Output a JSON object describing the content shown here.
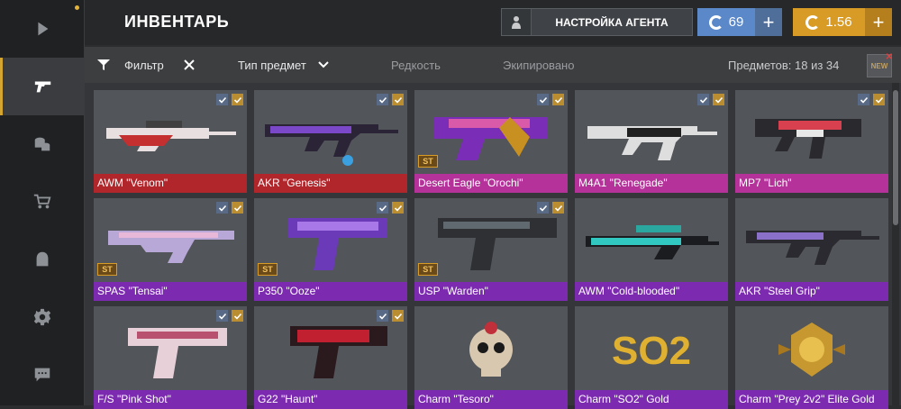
{
  "sidebar": {
    "items": [
      {
        "icon": "play-icon"
      },
      {
        "icon": "pistol-icon",
        "active": true
      },
      {
        "icon": "coins-icon"
      },
      {
        "icon": "cart-icon"
      },
      {
        "icon": "agent-icon"
      },
      {
        "icon": "gear-icon"
      },
      {
        "icon": "chat-icon"
      }
    ]
  },
  "header": {
    "title": "ИНВЕНТАРЬ",
    "agent_button": "НАСТРОЙКА АГЕНТА",
    "currency1": "69",
    "currency2": "1.56"
  },
  "filterbar": {
    "filter_label": "Фильтр",
    "type_label": "Тип предмет",
    "rarity_label": "Редкость",
    "equipped_label": "Экипировано",
    "count_label": "Предметов: 18 из 34",
    "new_label": "NEW"
  },
  "colors": {
    "accent": "#d89b26",
    "blue": "#5b88c9",
    "red": "#b0262b",
    "pink": "#b5329a",
    "purple": "#7c2ab0"
  },
  "items": [
    {
      "name": "AWM \"Venom\"",
      "color": "red",
      "st": false,
      "checks": 2
    },
    {
      "name": "AKR \"Genesis\"",
      "color": "red",
      "st": false,
      "checks": 2
    },
    {
      "name": "Desert Eagle \"Orochi\"",
      "color": "pink",
      "st": true,
      "st_label": "ST",
      "checks": 2
    },
    {
      "name": "M4A1 \"Renegade\"",
      "color": "pink",
      "st": false,
      "checks": 2
    },
    {
      "name": "MP7 \"Lich\"",
      "color": "pink",
      "st": false,
      "checks": 2
    },
    {
      "name": "SPAS \"Tensai\"",
      "color": "purple",
      "st": true,
      "st_label": "ST",
      "checks": 2
    },
    {
      "name": "P350 \"Ooze\"",
      "color": "purple",
      "st": true,
      "st_label": "ST",
      "checks": 2
    },
    {
      "name": "USP \"Warden\"",
      "color": "purple",
      "st": true,
      "st_label": "ST",
      "checks": 2
    },
    {
      "name": "AWM \"Cold-blooded\"",
      "color": "purple",
      "st": false,
      "checks": 0
    },
    {
      "name": "AKR \"Steel Grip\"",
      "color": "purple",
      "st": false,
      "checks": 0
    },
    {
      "name": "F/S \"Pink Shot\"",
      "color": "purple",
      "st": false,
      "checks": 2
    },
    {
      "name": "G22 \"Haunt\"",
      "color": "purple",
      "st": false,
      "checks": 2
    },
    {
      "name": "Charm \"Tesoro\"",
      "color": "purple",
      "st": false,
      "checks": 0
    },
    {
      "name": "Charm \"SO2\" Gold",
      "color": "purple",
      "st": false,
      "checks": 0
    },
    {
      "name": "Charm \"Prey 2v2\" Elite Gold",
      "color": "purple",
      "st": false,
      "checks": 0
    }
  ]
}
